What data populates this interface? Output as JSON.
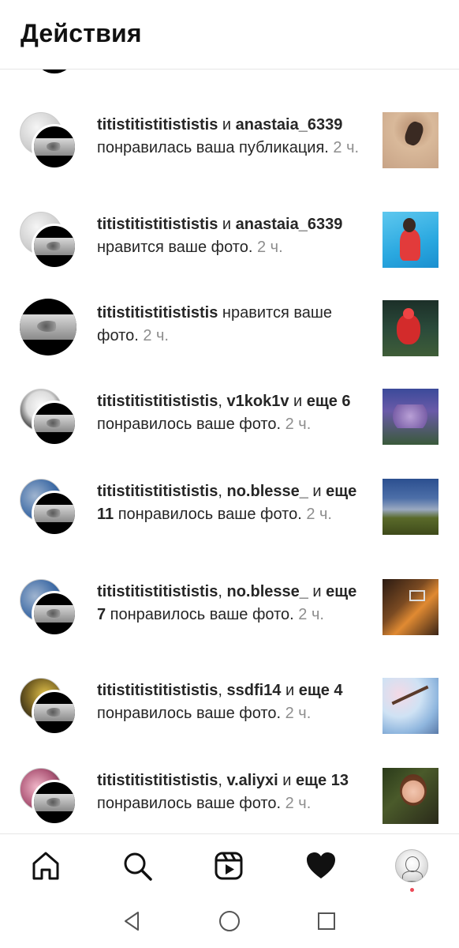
{
  "header": {
    "title": "Действия"
  },
  "notifications": [
    {
      "user1": "titistitistitististis",
      "joiner": " и ",
      "user2": "anastaia_6339",
      "rest": " понравилась ваша публикация.",
      "time": "2 ч."
    },
    {
      "user1": "titistitistitististis",
      "joiner": " и ",
      "user2": "anastaia_6339",
      "rest": " нравится ваше фото.",
      "time": "2 ч."
    },
    {
      "user1": "titistitistitististis",
      "rest": " нравится ваше фото.",
      "time": "2 ч."
    },
    {
      "user1": "titistitistitististis",
      "joiner": ", ",
      "user2": "v1kok1v",
      "mid": " и ",
      "more": "еще 6",
      "rest": " понравилось ваше фото.",
      "time": "2 ч."
    },
    {
      "user1": "titistitistitististis",
      "joiner": ", ",
      "user2": "no.blesse_",
      "mid": " и ",
      "more": "еще 11",
      "rest": " понравилось ваше фото.",
      "time": "2 ч."
    },
    {
      "user1": "titistitistitististis",
      "joiner": ", ",
      "user2": "no.blesse_",
      "mid": " и ",
      "more": "еще 7",
      "rest": " понравилось ваше фото.",
      "time": "2 ч."
    },
    {
      "user1": "titistitistitististis",
      "joiner": ", ",
      "user2": "ssdfi14",
      "mid": " и ",
      "more": "еще 4",
      "rest": " понравилось ваше фото.",
      "time": "2 ч."
    },
    {
      "user1": "titistitistitististis",
      "joiner": ", ",
      "user2": "v.aliyxi",
      "mid": " и ",
      "more": "еще 13",
      "rest": " понравилось ваше фото.",
      "time": "2 ч."
    }
  ],
  "bottom_nav": [
    "home-icon",
    "search-icon",
    "reels-icon",
    "heart-icon",
    "profile-avatar"
  ],
  "colors": {
    "text": "#262626",
    "secondary": "#8e8e8e",
    "badge": "#ed4956"
  }
}
